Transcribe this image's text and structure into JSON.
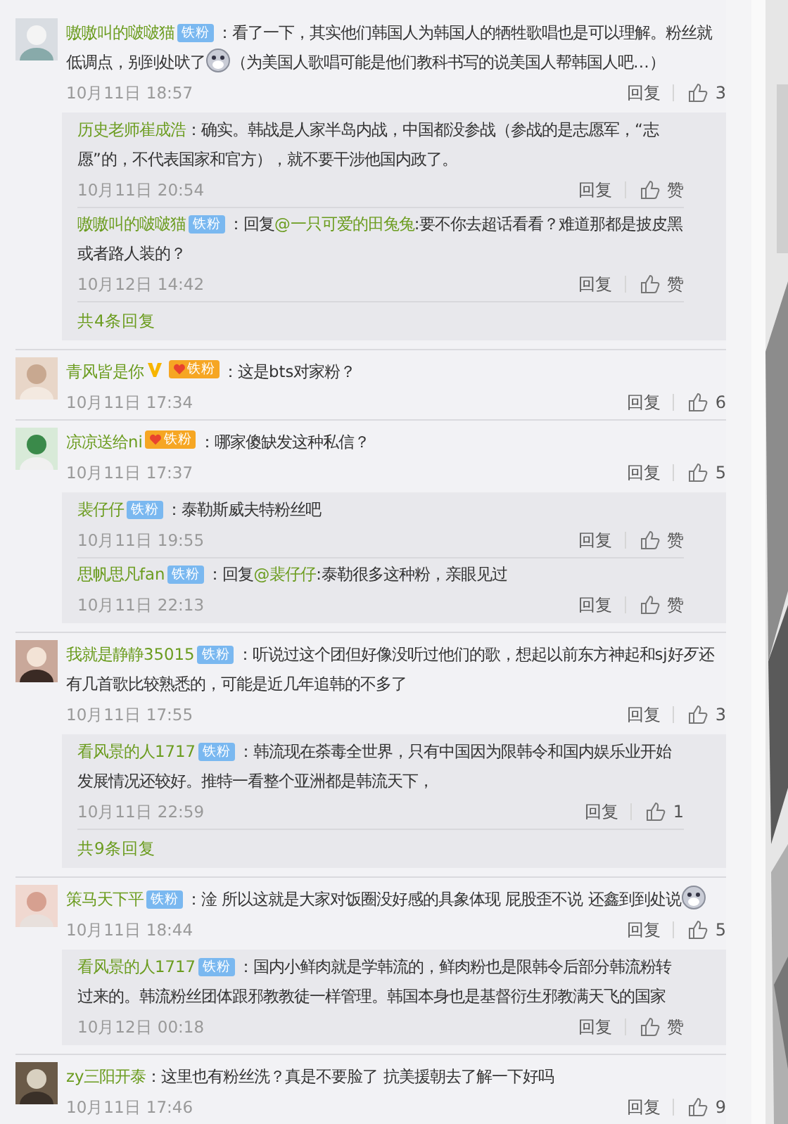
{
  "comments": [
    {
      "name": "嗷嗷叫的啵啵猫",
      "verified": false,
      "badge": {
        "kind": "blue",
        "text": "铁粉"
      },
      "content": [
        {
          "kind": "text",
          "text": "：看了一下，其实他们韩国人为韩国人的牺牲歌唱也是可以理解。粉丝就低调点，别到处吠了"
        },
        {
          "kind": "emoji"
        },
        {
          "kind": "text",
          "text": "（为美国人歌唱可能是他们教科书写的说美国人帮韩国人吧…）"
        }
      ],
      "time": "10月11日 18:57",
      "reply_label": "回复",
      "likes": "3",
      "replies": [
        {
          "name": "历史老师崔成浩",
          "content": [
            {
              "kind": "text",
              "text": "：确实。韩战是人家半岛内战，中国都没参战（参战的是志愿军，“志愿”的，不代表国家和官方），就不要干涉他国内政了。"
            }
          ],
          "time": "10月11日 20:54",
          "reply_label": "回复",
          "likes": "赞"
        },
        {
          "name": "嗷嗷叫的啵啵猫",
          "badge": {
            "kind": "blue",
            "text": "铁粉"
          },
          "content": [
            {
              "kind": "text",
              "text": "：回复"
            },
            {
              "kind": "mention",
              "text": "@一只可爱的田兔兔"
            },
            {
              "kind": "text",
              "text": ":要不你去超话看看？难道那都是披皮黑或者路人装的？"
            }
          ],
          "time": "10月12日 14:42",
          "reply_label": "回复",
          "likes": "赞"
        }
      ],
      "more": "共4条回复"
    },
    {
      "name": "青风皆是你",
      "verified": true,
      "badge": {
        "kind": "gold",
        "text": "铁粉"
      },
      "content": [
        {
          "kind": "text",
          "text": "：这是bts对家粉？"
        }
      ],
      "time": "10月11日 17:34",
      "reply_label": "回复",
      "likes": "6"
    },
    {
      "name": "凉凉送给ni",
      "verified": false,
      "badge": {
        "kind": "gold",
        "text": "铁粉"
      },
      "content": [
        {
          "kind": "text",
          "text": "：哪家傻缺发这种私信？"
        }
      ],
      "time": "10月11日 17:37",
      "reply_label": "回复",
      "likes": "5",
      "replies": [
        {
          "name": "裴仔仔",
          "badge": {
            "kind": "blue",
            "text": "铁粉"
          },
          "content": [
            {
              "kind": "text",
              "text": "：泰勒斯威夫特粉丝吧"
            }
          ],
          "time": "10月11日 19:55",
          "reply_label": "回复",
          "likes": "赞"
        },
        {
          "name": "思帆思凡fan",
          "badge": {
            "kind": "blue",
            "text": "铁粉"
          },
          "content": [
            {
              "kind": "text",
              "text": "：回复"
            },
            {
              "kind": "mention",
              "text": "@裴仔仔"
            },
            {
              "kind": "text",
              "text": ":泰勒很多这种粉，亲眼见过"
            }
          ],
          "time": "10月11日 22:13",
          "reply_label": "回复",
          "likes": "赞"
        }
      ]
    },
    {
      "name": "我就是静静35015",
      "verified": false,
      "badge": {
        "kind": "blue",
        "text": "铁粉"
      },
      "content": [
        {
          "kind": "text",
          "text": "：听说过这个团但好像没听过他们的歌，想起以前东方神起和sj好歹还有几首歌比较熟悉的，可能是近几年追韩的不多了"
        }
      ],
      "time": "10月11日 17:55",
      "reply_label": "回复",
      "likes": "3",
      "replies": [
        {
          "name": "看风景的人1717",
          "badge": {
            "kind": "blue",
            "text": "铁粉"
          },
          "content": [
            {
              "kind": "text",
              "text": "：韩流现在荼毒全世界，只有中国因为限韩令和国内娱乐业开始发展情况还较好。推特一看整个亚洲都是韩流天下，"
            }
          ],
          "time": "10月11日 22:59",
          "reply_label": "回复",
          "likes": "1"
        }
      ],
      "more": "共9条回复"
    },
    {
      "name": "策马天下平",
      "verified": false,
      "badge": {
        "kind": "blue",
        "text": "铁粉"
      },
      "content": [
        {
          "kind": "text",
          "text": "：淦 所以这就是大家对饭圈没好感的具象体现 屁股歪不说 还鑫到到处说"
        },
        {
          "kind": "emoji"
        }
      ],
      "time": "10月11日 18:44",
      "reply_label": "回复",
      "likes": "5",
      "replies": [
        {
          "name": "看风景的人1717",
          "badge": {
            "kind": "blue",
            "text": "铁粉"
          },
          "content": [
            {
              "kind": "text",
              "text": "：国内小鲜肉就是学韩流的，鲜肉粉也是限韩令后部分韩流粉转过来的。韩流粉丝团体跟邪教教徒一样管理。韩国本身也是基督衍生邪教满天飞的国家"
            }
          ],
          "time": "10月12日 00:18",
          "reply_label": "回复",
          "likes": "赞"
        }
      ]
    },
    {
      "name": "zy三阳开泰",
      "verified": false,
      "content": [
        {
          "kind": "text",
          "text": "：这里也有粉丝洗？真是不要脸了 抗美援朝去了解一下好吗"
        }
      ],
      "time": "10月11日 17:46",
      "reply_label": "回复",
      "likes": "9"
    }
  ]
}
